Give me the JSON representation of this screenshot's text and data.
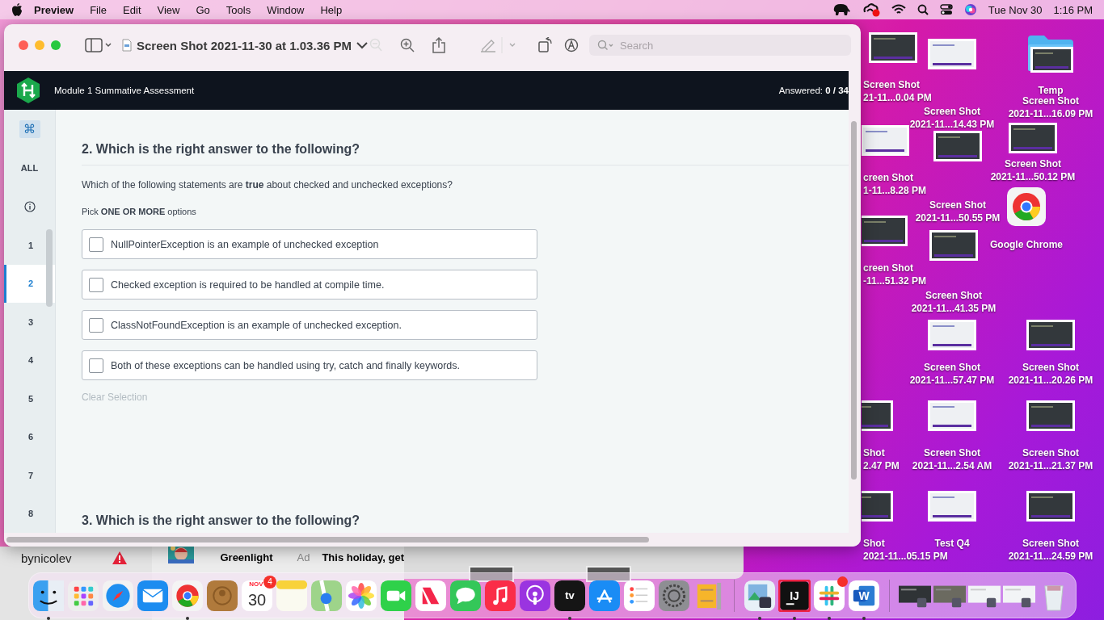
{
  "menu_bar": {
    "app_name": "Preview",
    "menus": [
      "File",
      "Edit",
      "View",
      "Go",
      "Tools",
      "Window",
      "Help"
    ],
    "date": "Tue Nov 30",
    "time": "1:16 PM"
  },
  "preview_window": {
    "title": "Screen Shot 2021-11-30 at 1.03.36 PM",
    "search": {
      "placeholder": "Search"
    }
  },
  "assessment": {
    "title": "Module 1 Summative Assessment",
    "answered": "Answered: **0 / 34**",
    "nav": {
      "shortcut_symbol": "⌘",
      "all_label": "ALL",
      "items": [
        {
          "label": "1",
          "selected": false
        },
        {
          "label": "2",
          "selected": true
        },
        {
          "label": "3",
          "selected": false
        },
        {
          "label": "4",
          "selected": false
        },
        {
          "label": "5",
          "selected": false
        },
        {
          "label": "6",
          "selected": false
        },
        {
          "label": "7",
          "selected": false
        },
        {
          "label": "8",
          "selected": false
        }
      ]
    },
    "question": {
      "heading": "2. Which is the right answer to the following?",
      "prompt": "Which of the following statements are **true** about checked and unchecked exceptions?",
      "instruction": "Pick **ONE OR MORE** options",
      "options": [
        {
          "text": "NullPointerException is an example of unchecked exception",
          "checked": false
        },
        {
          "text": "Checked exception is required to be handled at compile time.",
          "checked": false
        },
        {
          "text": "ClassNotFoundException is an example of unchecked exception.",
          "checked": false
        },
        {
          "text": "Both of these exceptions can be handled using try, catch and finally keywords.",
          "checked": false
        }
      ],
      "clear_label": "Clear Selection"
    },
    "next_heading": "3. Which is the right answer to the following?"
  },
  "desktop_icons": [
    {
      "kind": "screenshot",
      "lines": [
        "Screen Shot",
        "21-11...0.04 PM"
      ]
    },
    {
      "kind": "screenshot",
      "lines": [
        "Screen Shot",
        "2021-11...14.43 PM"
      ]
    },
    {
      "kind": "folder",
      "lines": [
        "Temp"
      ]
    },
    {
      "kind": "screenshot",
      "lines": [
        "Screen Shot",
        "2021-11...16.09 PM"
      ]
    },
    {
      "kind": "screenshot",
      "lines": [
        "creen Shot",
        "1-11...8.28 PM"
      ]
    },
    {
      "kind": "screenshot",
      "lines": [
        "Screen Shot",
        "2021-11...50.55 PM"
      ]
    },
    {
      "kind": "screenshot",
      "lines": [
        "Screen Shot",
        "2021-11...50.12 PM"
      ]
    },
    {
      "kind": "app",
      "lines": [
        "Google Chrome"
      ]
    },
    {
      "kind": "screenshot",
      "lines": [
        "creen Shot",
        "-11...51.32 PM"
      ]
    },
    {
      "kind": "screenshot",
      "lines": [
        "Screen Shot",
        "2021-11...41.35 PM"
      ]
    },
    {
      "kind": "screenshot",
      "lines": [
        "Screen Shot",
        "2021-11...57.47 PM"
      ]
    },
    {
      "kind": "screenshot",
      "lines": [
        "Screen Shot",
        "2021-11...20.26 PM"
      ]
    },
    {
      "kind": "screenshot",
      "lines": [
        "Shot",
        "2.47 PM"
      ]
    },
    {
      "kind": "screenshot",
      "lines": [
        "Screen Shot",
        "2021-11...2.54 AM"
      ]
    },
    {
      "kind": "screenshot",
      "lines": [
        "Screen Shot",
        "2021-11...21.37 PM"
      ]
    },
    {
      "kind": "screenshot",
      "lines": [
        "Shot",
        "2021-11...05.15 PM"
      ]
    },
    {
      "kind": "screenshot",
      "lines": [
        "Test Q4"
      ]
    },
    {
      "kind": "screenshot",
      "lines": [
        "Screen Shot",
        "2021-11...24.59 PM"
      ]
    }
  ],
  "background_window": {
    "account": "bynicolev",
    "ad_row": {
      "sender": "Greenlight",
      "tag": "Ad",
      "subject": "This holiday, get"
    }
  },
  "dock": {
    "items": [
      {
        "kind": "finder",
        "running": true
      },
      {
        "kind": "launchpad",
        "running": false
      },
      {
        "kind": "safari",
        "running": false
      },
      {
        "kind": "mail",
        "running": false
      },
      {
        "kind": "chrome",
        "running": true
      },
      {
        "kind": "contacts",
        "running": false
      },
      {
        "kind": "calendar",
        "running": false,
        "month": "NOV",
        "day": "30",
        "badge": "4"
      },
      {
        "kind": "notes",
        "running": false
      },
      {
        "kind": "maps",
        "running": false
      },
      {
        "kind": "photos",
        "running": false
      },
      {
        "kind": "facetime",
        "running": false
      },
      {
        "kind": "news",
        "running": false
      },
      {
        "kind": "messages",
        "running": false
      },
      {
        "kind": "music",
        "running": false
      },
      {
        "kind": "podcasts",
        "running": false
      },
      {
        "kind": "tv",
        "running": true,
        "label": "tv"
      },
      {
        "kind": "appstore",
        "running": false
      },
      {
        "kind": "reminders",
        "running": false
      },
      {
        "kind": "settings",
        "running": false
      },
      {
        "kind": "archive",
        "running": false
      },
      {
        "kind": "separator"
      },
      {
        "kind": "preview",
        "running": true
      },
      {
        "kind": "intellij",
        "running": true,
        "label": "IJ"
      },
      {
        "kind": "slack",
        "running": true,
        "badge_dot": true
      },
      {
        "kind": "word",
        "running": true,
        "label": "W"
      },
      {
        "kind": "separator"
      },
      {
        "kind": "thumb_dark"
      },
      {
        "kind": "thumb_video"
      },
      {
        "kind": "thumb_light"
      },
      {
        "kind": "thumb_light"
      },
      {
        "kind": "trash"
      }
    ]
  }
}
